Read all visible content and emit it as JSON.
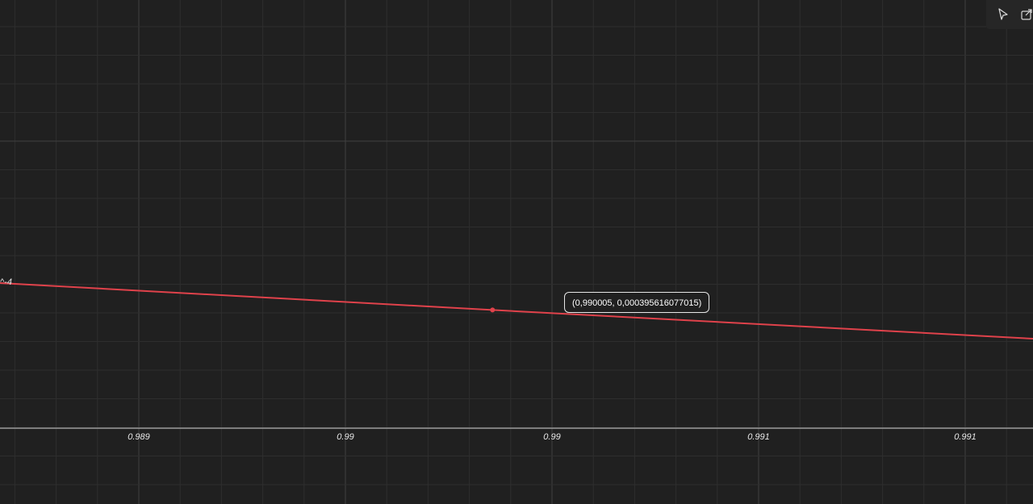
{
  "chart_data": {
    "type": "line",
    "x_tick_labels": [
      "0.989",
      "0.99",
      "0.99",
      "0.991",
      "0.991"
    ],
    "y_tick_label_partial": "^-4",
    "series": [
      {
        "x": [
          0.98867,
          0.990005,
          0.99147
        ],
        "y": [
          0.0004082,
          0.000395616077015,
          0.0003822
        ]
      }
    ],
    "xlim": [
      0.98867,
      0.99147
    ],
    "ylim": [
      0.000383,
      0.000417
    ],
    "grid": true,
    "colors": {
      "line": "#e0424b",
      "grid_minor": "#2e2e2e",
      "grid_major": "#404040",
      "axis": "#9a9a9a",
      "background": "#202020"
    }
  },
  "tooltip": {
    "text": "(0,990005, 0,000395616077015)"
  },
  "toolbar": {
    "cursor_icon": "cursor-icon",
    "share_icon": "share-icon"
  }
}
